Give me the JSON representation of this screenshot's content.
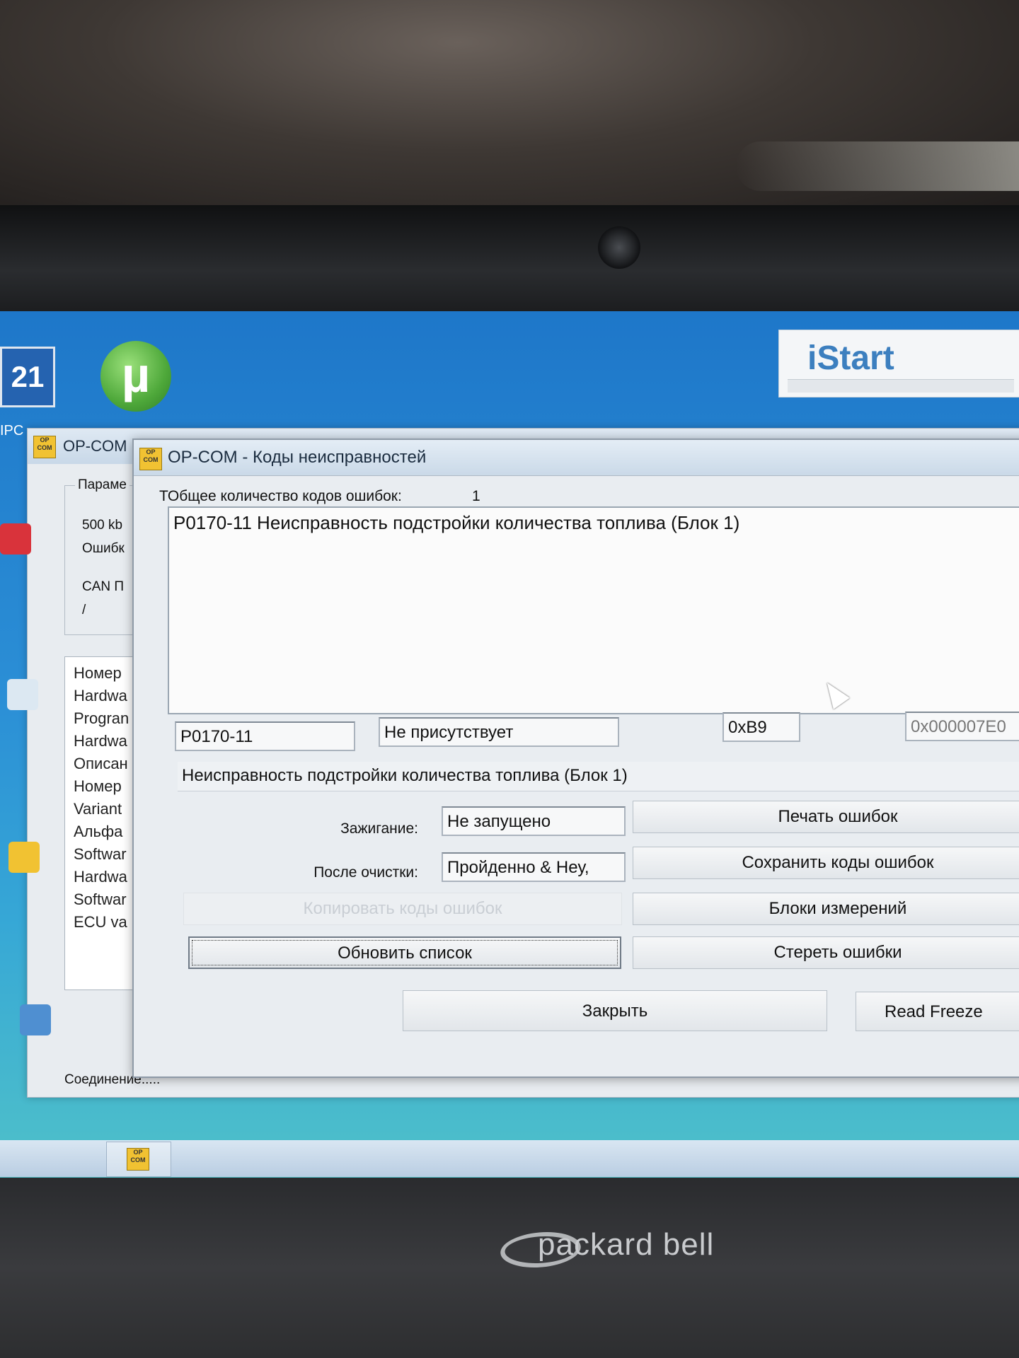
{
  "desktop": {
    "icon_21_label": "21",
    "icon_utorrent_glyph": "µ",
    "ipc_label": "IPC",
    "istart_title": "iStart"
  },
  "main_window": {
    "title": "OP-COM",
    "params_title": "Параме",
    "params_lines": [
      "500 kb",
      "Ошибк",
      "CAN П",
      "/"
    ],
    "info_items": [
      "Номер",
      "Hardwa",
      "Progran",
      "Hardwa",
      "Описан",
      "Номер",
      "Variant",
      "Альфа",
      "Softwar",
      "Hardwa",
      "Softwar",
      "ECU va"
    ],
    "status": "Соединение....."
  },
  "dialog": {
    "logo": "OP COM",
    "title": "OP-COM - Коды неисправностей",
    "total_label": "ТОбщее количество кодов ошибок:",
    "total_count": "1",
    "codes": [
      "P0170-11 Неисправность подстройки количества топлива (Блок 1)"
    ],
    "code_field": "P0170-11",
    "status_field": "Не присутствует",
    "hex_field_1": "0xB9",
    "hex_field_2": "0x000007E0",
    "description_field": "Неисправность подстройки количества топлива (Блок 1)",
    "ignition_label": "Зажигание:",
    "ignition_value": "Не запущено",
    "after_clear_label": "После очистки:",
    "after_clear_value": "Пройденно & Неу,",
    "buttons": {
      "print": "Печать ошибок",
      "save": "Сохранить коды ошибок",
      "copy": "Копировать коды ошибок",
      "blocks": "Блоки измерений",
      "refresh": "Обновить список",
      "erase": "Стереть ошибки",
      "close": "Закрыть",
      "freeze": "Read Freeze"
    }
  },
  "laptop": {
    "brand": "packard bell"
  }
}
